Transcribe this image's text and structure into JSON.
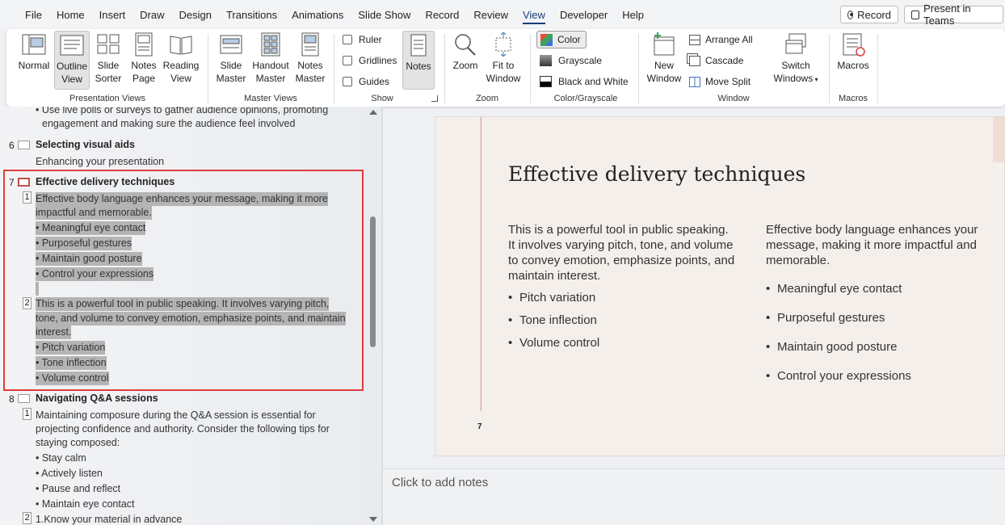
{
  "tabs": [
    "File",
    "Home",
    "Insert",
    "Draw",
    "Design",
    "Transitions",
    "Animations",
    "Slide Show",
    "Record",
    "Review",
    "View",
    "Developer",
    "Help"
  ],
  "active_tab": "View",
  "top_buttons": {
    "record": "Record",
    "present": "Present in Teams"
  },
  "ribbon": {
    "presentation_views": {
      "label": "Presentation Views",
      "normal": "Normal",
      "outline_1": "Outline",
      "outline_2": "View",
      "sorter_1": "Slide",
      "sorter_2": "Sorter",
      "notes_page_1": "Notes",
      "notes_page_2": "Page",
      "reading_1": "Reading",
      "reading_2": "View"
    },
    "master_views": {
      "label": "Master Views",
      "slide_1": "Slide",
      "slide_2": "Master",
      "handout_1": "Handout",
      "handout_2": "Master",
      "notes_1": "Notes",
      "notes_2": "Master"
    },
    "show": {
      "label": "Show",
      "ruler": "Ruler",
      "gridlines": "Gridlines",
      "guides": "Guides",
      "notes": "Notes"
    },
    "zoom": {
      "label": "Zoom",
      "zoom": "Zoom",
      "fit_1": "Fit to",
      "fit_2": "Window"
    },
    "color": {
      "label": "Color/Grayscale",
      "color": "Color",
      "grayscale": "Grayscale",
      "bw": "Black and White"
    },
    "window": {
      "label": "Window",
      "new_1": "New",
      "new_2": "Window",
      "arrange": "Arrange All",
      "cascade": "Cascade",
      "split": "Move Split",
      "switch_1": "Switch",
      "switch_2": "Windows"
    },
    "macros": {
      "label": "Macros",
      "macros": "Macros"
    }
  },
  "outline": {
    "prev_1": "• Use live polls or surveys to gather audience opinions, promoting",
    "prev_2": "engagement and making sure the audience feel involved",
    "s6": {
      "num": "6",
      "title": "Selecting visual aids",
      "sub": "Enhancing your presentation"
    },
    "s7": {
      "num": "7",
      "title": "Effective delivery techniques",
      "p1_num": "1",
      "p1_1": "Effective body language enhances your message, making it more",
      "p1_2": "impactful and memorable.",
      "b1": "• Meaningful eye contact",
      "b2": "• Purposeful gestures",
      "b3": "• Maintain good posture",
      "b4": "• Control your expressions",
      "p2_num": "2",
      "p2_1": "This is a powerful tool in public speaking. It involves varying pitch,",
      "p2_2": "tone, and volume to convey emotion, emphasize points, and maintain",
      "p2_3": "interest.",
      "c1": "• Pitch variation",
      "c2": "• Tone inflection",
      "c3": "• Volume control"
    },
    "s8": {
      "num": "8",
      "title": "Navigating Q&A sessions",
      "p1_num": "1",
      "p1_1": "Maintaining composure during the Q&A session is essential for",
      "p1_2": "projecting confidence and authority. Consider the following tips for",
      "p1_3": "staying composed:",
      "b1": "• Stay calm",
      "b2": "• Actively listen",
      "b3": "• Pause and reflect",
      "b4": "• Maintain eye contact",
      "p2_num": "2",
      "p2_1": "1.Know your material in advance"
    }
  },
  "slide": {
    "title": "Effective delivery techniques",
    "left_para": "This is a powerful tool in public speaking. It involves varying pitch, tone, and volume to convey emotion, emphasize points, and maintain interest.",
    "left_bullets": [
      "Pitch variation",
      "Tone inflection",
      "Volume control"
    ],
    "right_para": "Effective body language enhances your message, making it more impactful and memorable.",
    "right_bullets": [
      "Meaningful eye contact",
      "Purposeful gestures",
      "Maintain good posture",
      "Control your expressions"
    ],
    "number": "7"
  },
  "notes_placeholder": "Click to add notes",
  "colors": {
    "accent": "#1a3f7a",
    "selection": "#e03c3c",
    "highlight": "#b4b4b4",
    "slide_bg": "#f4efea"
  }
}
